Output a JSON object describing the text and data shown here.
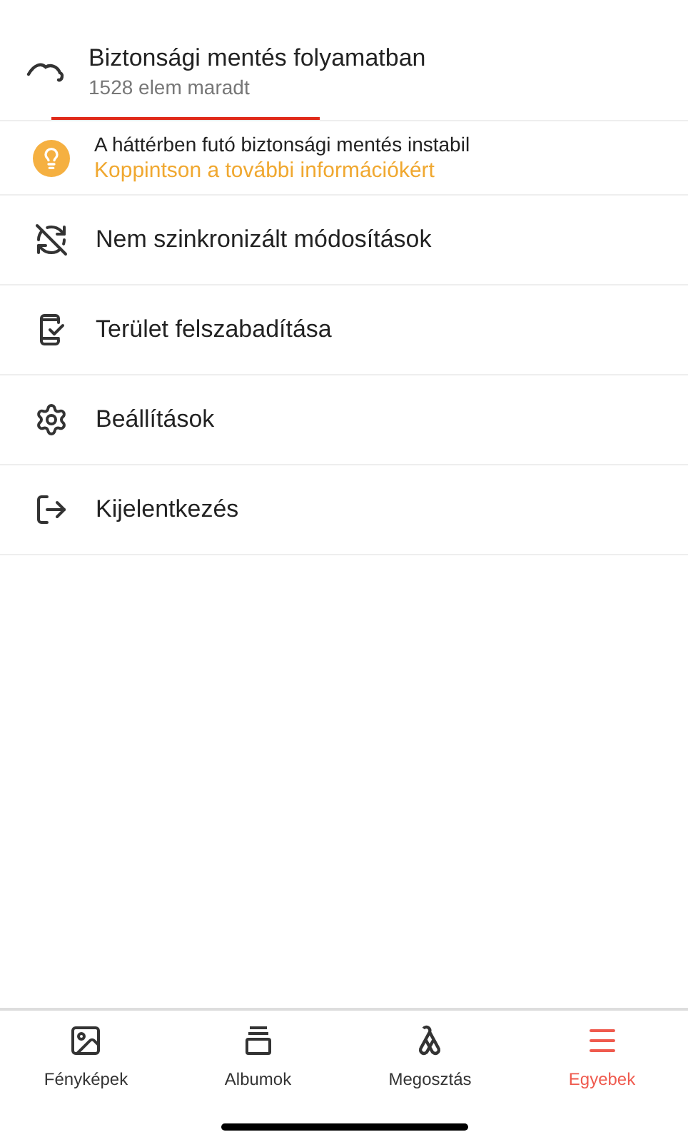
{
  "backup": {
    "title": "Biztonsági mentés folyamatban",
    "subtitle": "1528 elem maradt"
  },
  "notice": {
    "text": "A háttérben futó biztonsági mentés instabil",
    "link": "Koppintson a további információkért"
  },
  "menu": [
    {
      "kind": "sync-off",
      "label": "Nem szinkronizált módosítások"
    },
    {
      "kind": "free-space",
      "label": "Terület felszabadítása"
    },
    {
      "kind": "settings",
      "label": "Beállítások"
    },
    {
      "kind": "logout",
      "label": "Kijelentkezés"
    }
  ],
  "tabs": [
    {
      "kind": "photos",
      "label": "Fényképek",
      "selected": false
    },
    {
      "kind": "albums",
      "label": "Albumok",
      "selected": false
    },
    {
      "kind": "sharing",
      "label": "Megosztás",
      "selected": false
    },
    {
      "kind": "more",
      "label": "Egyebek",
      "selected": true
    }
  ]
}
